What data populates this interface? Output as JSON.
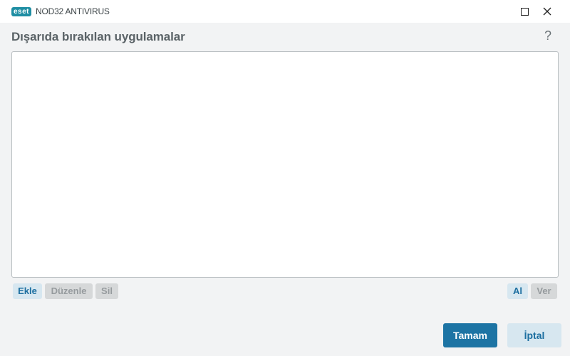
{
  "titlebar": {
    "logo_text": "eset",
    "product_name": "NOD32 ANTIVIRUS",
    "maximize_icon": "maximize-icon",
    "close_icon": "close-icon"
  },
  "header": {
    "title": "Dışarıda bırakılan uygulamalar",
    "help_label": "?"
  },
  "list": {
    "items": []
  },
  "list_actions": {
    "add_label": "Ekle",
    "edit_label": "Düzenle",
    "delete_label": "Sil",
    "import_label": "Al",
    "export_label": "Ver"
  },
  "footer": {
    "ok_label": "Tamam",
    "cancel_label": "İptal"
  },
  "colors": {
    "brand": "#1f8ea3",
    "primary_button": "#1d74a4",
    "secondary_button": "#d7e7f0",
    "disabled_button": "#d6d8d9",
    "background": "#f2f3f4"
  }
}
